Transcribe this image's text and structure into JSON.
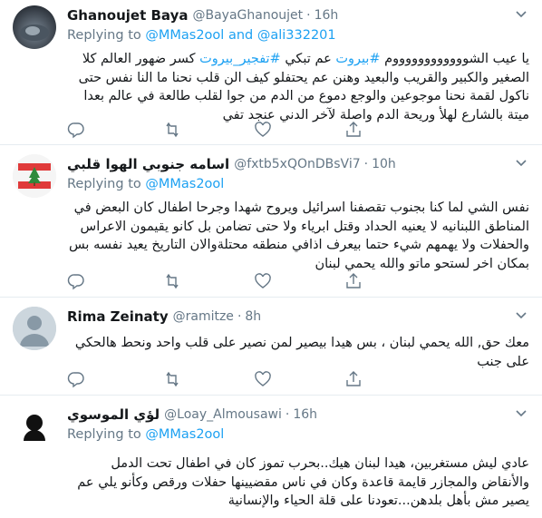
{
  "tweets": [
    {
      "name": "Ghanoujet Baya",
      "handle": "@BayaGhanoujet",
      "dot": "·",
      "time": "16h",
      "reply_prefix": "Replying to",
      "reply_user1": "@MMas2ool",
      "reply_and": "and",
      "reply_user2": "@ali332201",
      "text_parts": {
        "t1": "يا عيب الشووووووووووووم ",
        "tag1": "#بيروت",
        "t2": " عم تبكي ",
        "tag2": "#تفجير_بيروت",
        "t3": " كسر ضهور العالم كلا الصغير والكبير والقريب والبعيد وهنن عم يحتفلو كيف الن قلب نحنا ما النا نفس حتى ناكول لقمة نحنا موجوعين والوجع دموع من الدم من جوا لقلب طالعة في عالم بعدا ميتة بالشارع لهلأ وريحة الدم واصلة لآخر الدني عنجد تفي"
      }
    },
    {
      "name": "اسامه جنوبي الهوا قلبي",
      "handle": "@fxtb5xQOnDBsVi7",
      "dot": "·",
      "time": "10h",
      "reply_prefix": "Replying to",
      "reply_user1": "@MMas2ool",
      "text": "نفس الشي لما كنا بجنوب تقصفنا اسرائيل ويروح شهدا وجرحا اطفال كان البعض في المناطق اللبنانيه لا يعنيه الحداد وقتل ابرياء ولا حتى تضامن بل كانو يقيمون الاعراس والحفلات ولا يهمهم شيء حتما بيعرف اذافي منطقه محتلةوالان التاريخ يعيد نفسه بس بمكان اخر لستحو ماتو والله يحمي لبنان"
    },
    {
      "name": "Rima Zeinaty",
      "handle": "@ramitze",
      "dot": "·",
      "time": "8h",
      "text": "معك حق, الله يحمي لبنان ، بس هيدا بيصير لمن نصير على قلب واحد ونحط هالحكي على جنب"
    },
    {
      "name": "لؤي الموسوي",
      "handle": "@Loay_Almousawi",
      "dot": "·",
      "time": "16h",
      "reply_prefix": "Replying to",
      "reply_user1": "@MMas2ool",
      "text": "عادي ليش مستغربين، هيدا لبنان هيك..بحرب تموز كان في اطفال تحت الدمل والأنقاض والمجازر قايمة قاعدة وكان في ناس مقضيينها حفلات ورقص وكأنو يلي عم يصير مش بأهل بلدهن...تعودنا على قلة الحياء والإنسانية"
    }
  ],
  "icons": [
    "reply-icon",
    "retweet-icon",
    "like-icon",
    "share-icon",
    "caret-down-icon"
  ],
  "colors": {
    "link": "#1da1f2",
    "muted": "#657786",
    "text": "#14171a",
    "divider": "#e6ecf0"
  }
}
